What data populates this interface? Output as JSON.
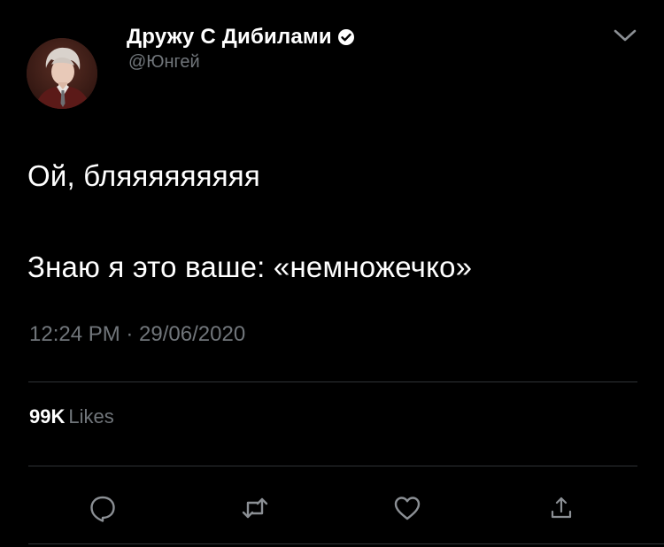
{
  "author": {
    "display_name": "Дружу С Дибилами",
    "handle": "@Юнгей",
    "verified": true,
    "avatar_icon": "profile-photo"
  },
  "tweet": {
    "lines": [
      "Ой, бляяяяяяяяя",
      "Знаю я это ваше: «немножечко»"
    ],
    "timestamp": "12:24 PM · 29/06/2020"
  },
  "stats": {
    "likes_count": "99K",
    "likes_label": "Likes"
  },
  "actions": [
    {
      "name": "reply",
      "icon": "reply-icon"
    },
    {
      "name": "retweet",
      "icon": "retweet-icon"
    },
    {
      "name": "like",
      "icon": "heart-icon"
    },
    {
      "name": "share",
      "icon": "share-icon"
    }
  ],
  "colors": {
    "background": "#000000",
    "text_primary": "#ffffff",
    "text_secondary": "#71767b",
    "divider": "#2f3336"
  }
}
